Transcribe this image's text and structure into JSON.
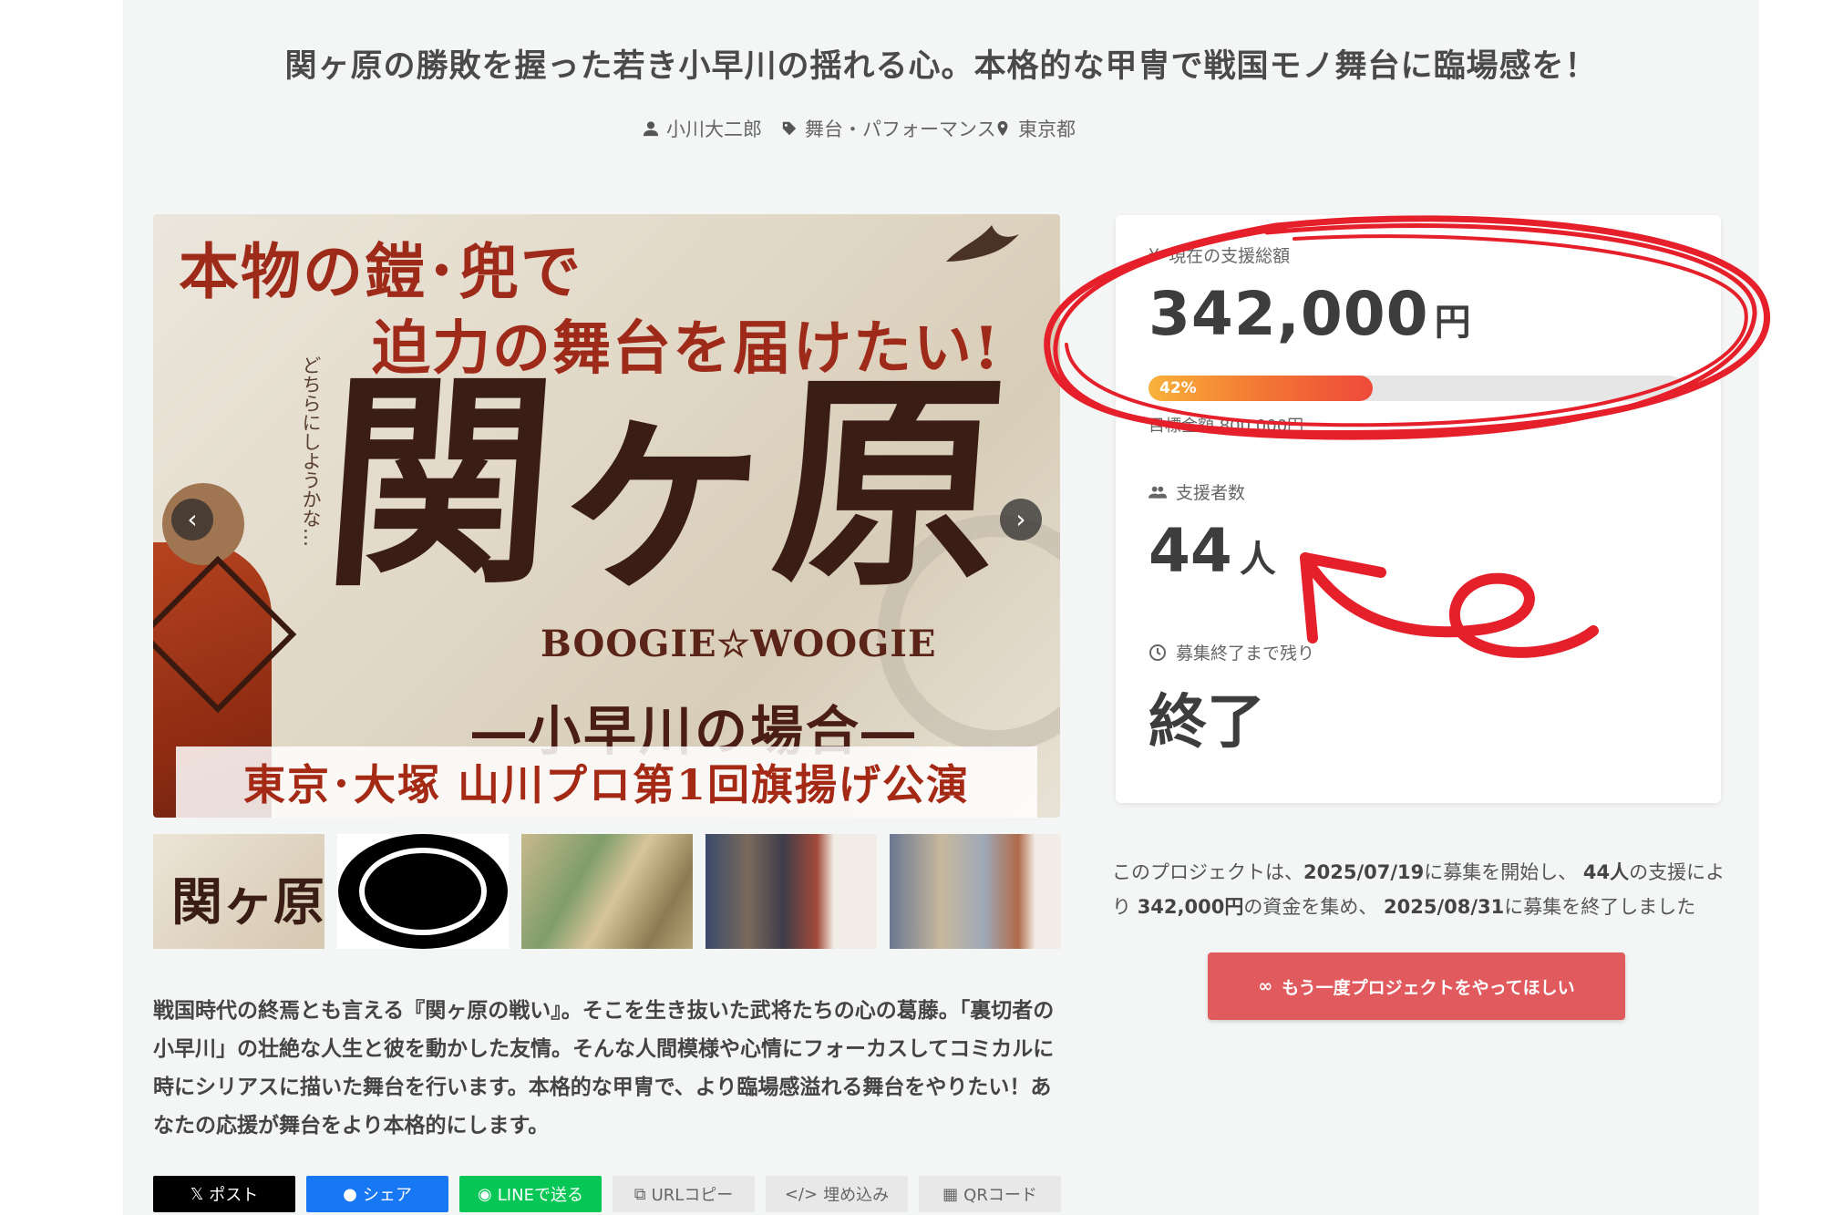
{
  "title": "関ヶ原の勝敗を握った若き小早川の揺れる心。本格的な甲冑で戦国モノ舞台に臨場感を！",
  "meta": {
    "owner": "小川大二郎",
    "category": "舞台・パフォーマンス",
    "location": "東京都"
  },
  "hero": {
    "line1": "本物の鎧･兜で",
    "line2": "迫力の舞台を届けたい!",
    "side_text": "どちらにしようかな…",
    "main_title": "関ヶ原",
    "subtitle": "BOOGIE☆WOOGIE",
    "subtitle2": "―小早川の場合―",
    "bottom_text": "東京･大塚 山川プロ第1回旗揚げ公演",
    "prev_icon": "chevron-left-icon",
    "next_icon": "chevron-right-icon"
  },
  "thumbnails": [
    {
      "name": "thumb-flyer",
      "text": "関ヶ原"
    },
    {
      "name": "thumb-crest",
      "text": ""
    },
    {
      "name": "thumb-battle-screen",
      "text": ""
    },
    {
      "name": "thumb-armor",
      "text": ""
    },
    {
      "name": "thumb-armor-detail",
      "text": ""
    }
  ],
  "description": "戦国時代の終焉とも言える『関ヶ原の戦い』。そこを生き抜いた武将たちの心の葛藤。「裏切者の小早川」の壮絶な人生と彼を動かした友情。そんな人間模様や心情にフォーカスしてコミカルに時にシリアスに描いた舞台を行います。本格的な甲冑で、より臨場感溢れる舞台をやりたい！あなたの応援が舞台をより本格的にします。",
  "share": {
    "x": "ポスト",
    "facebook": "シェア",
    "line": "LINEで送る",
    "url": "URLコピー",
    "embed": "埋め込み",
    "qr": "QRコード"
  },
  "panel": {
    "amount_label": "現在の支援総額",
    "amount": "342,000",
    "amount_unit": "円",
    "progress_percent": 42,
    "progress_label": "42%",
    "goal_text": "目標金額 800,000円",
    "backers_label": "支援者数",
    "backers": "44",
    "backers_unit": "人",
    "remaining_label": "募集終了まで残り",
    "remaining_value": "終了"
  },
  "summary": {
    "prefix": "このプロジェクトは、",
    "start_date": "2025/07/19",
    "mid1": "に募集を開始し、 ",
    "backers": "44人",
    "mid2": "の支援により ",
    "amount": "342,000円",
    "mid3": "の資金を集め、 ",
    "end_date": "2025/08/31",
    "suffix": "に募集を終了しました"
  },
  "again_button": "もう一度プロジェクトをやってほしい",
  "colors": {
    "accent_red": "#e05a5e",
    "annotation_red": "#e5202a",
    "progress_start": "#f8b23a",
    "progress_end": "#ee4a3a"
  }
}
